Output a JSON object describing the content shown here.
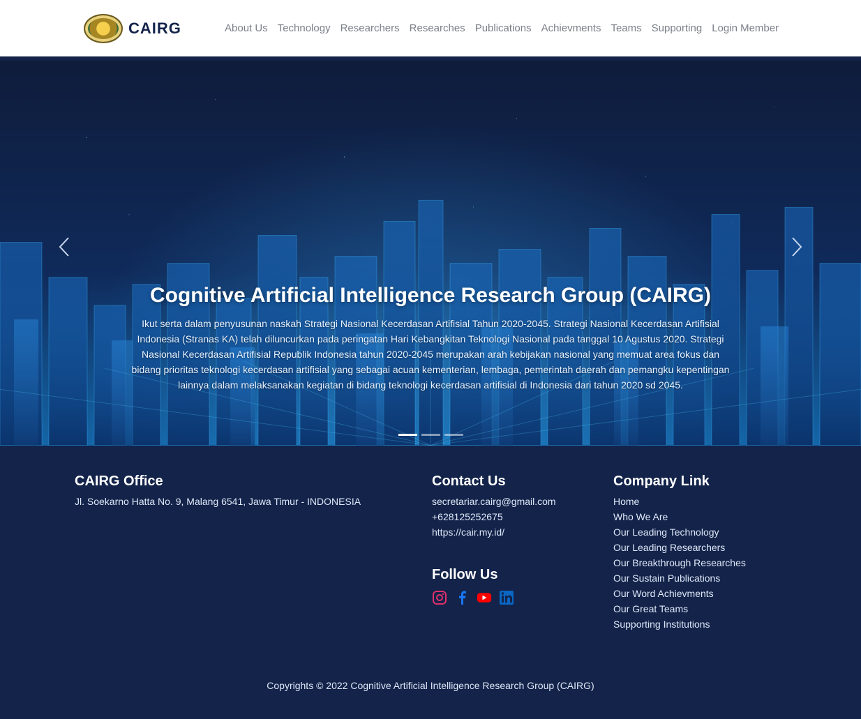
{
  "brand": {
    "name": "CAIRG"
  },
  "nav": [
    {
      "label": "About Us"
    },
    {
      "label": "Technology"
    },
    {
      "label": "Researchers"
    },
    {
      "label": "Researches"
    },
    {
      "label": "Publications"
    },
    {
      "label": "Achievments"
    },
    {
      "label": "Teams"
    },
    {
      "label": "Supporting"
    },
    {
      "label": "Login Member"
    }
  ],
  "hero": {
    "title": "Cognitive Artificial Intelligence Research Group (CAIRG)",
    "description": "Ikut serta dalam penyusunan naskah Strategi Nasional Kecerdasan Artifisial Tahun 2020-2045. Strategi Nasional Kecerdasan Artifisial Indonesia (Stranas KA) telah diluncurkan pada peringatan Hari Kebangkitan Teknologi Nasional pada tanggal 10 Agustus 2020. Strategi Nasional Kecerdasan Artifisial Republik Indonesia tahun 2020-2045 merupakan arah kebijakan nasional yang memuat area fokus dan bidang prioritas teknologi kecerdasan artifisial yang sebagai acuan kementerian, lembaga, pemerintah daerah dan pemangku kepentingan lainnya dalam melaksanakan kegiatan di bidang teknologi kecerdasan artifisial di Indonesia dari tahun 2020 sd 2045.",
    "slides": 3,
    "active_slide": 1,
    "prev_icon": "chevron-left-icon",
    "next_icon": "chevron-right-icon"
  },
  "footer": {
    "office": {
      "title": "CAIRG Office",
      "address": "Jl. Soekarno Hatta No. 9, Malang 6541, Jawa Timur - INDONESIA"
    },
    "contact": {
      "title": "Contact Us",
      "email": "secretariar.cairg@gmail.com",
      "phone": "+628125252675",
      "website": "https://cair.my.id/"
    },
    "follow": {
      "title": "Follow Us",
      "icons": [
        "instagram-icon",
        "facebook-icon",
        "youtube-icon",
        "linkedin-icon"
      ]
    },
    "company": {
      "title": "Company Link",
      "links": [
        "Home",
        "Who We Are",
        "Our Leading Technology",
        "Our Leading Researchers",
        "Our Breakthrough Researches",
        "Our Sustain Publications",
        "Our Word Achievments",
        "Our Great Teams",
        "Supporting Institutions"
      ]
    },
    "copyright": "Copyrights © 2022 Cognitive Artificial Intelligence Research Group (CAIRG)"
  },
  "colors": {
    "primary": "#13234a",
    "nav_text": "#7b7f88",
    "instagram": "#e1306c",
    "facebook": "#1877f2",
    "youtube": "#ff0000",
    "linkedin": "#0a66c2"
  }
}
